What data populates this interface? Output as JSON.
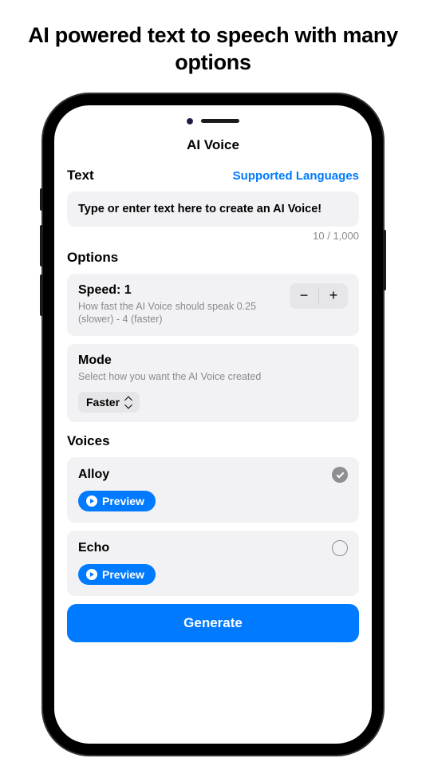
{
  "headline": "AI powered text to speech with many options",
  "app": {
    "title": "AI Voice",
    "text_section": {
      "label": "Text",
      "supported_link": "Supported Languages",
      "input_value": "Type or enter text here to create an AI Voice!",
      "counter": "10 / 1,000"
    },
    "options": {
      "label": "Options",
      "speed": {
        "title": "Speed: 1",
        "desc": "How fast the AI Voice should speak 0.25 (slower) - 4 (faster)",
        "minus": "−",
        "plus": "+"
      },
      "mode": {
        "title": "Mode",
        "desc": "Select how you want the AI Voice created",
        "selected": "Faster"
      }
    },
    "voices": {
      "label": "Voices",
      "items": [
        {
          "name": "Alloy",
          "checked": true,
          "preview": "Preview"
        },
        {
          "name": "Echo",
          "checked": false,
          "preview": "Preview"
        }
      ]
    },
    "generate": "Generate"
  }
}
